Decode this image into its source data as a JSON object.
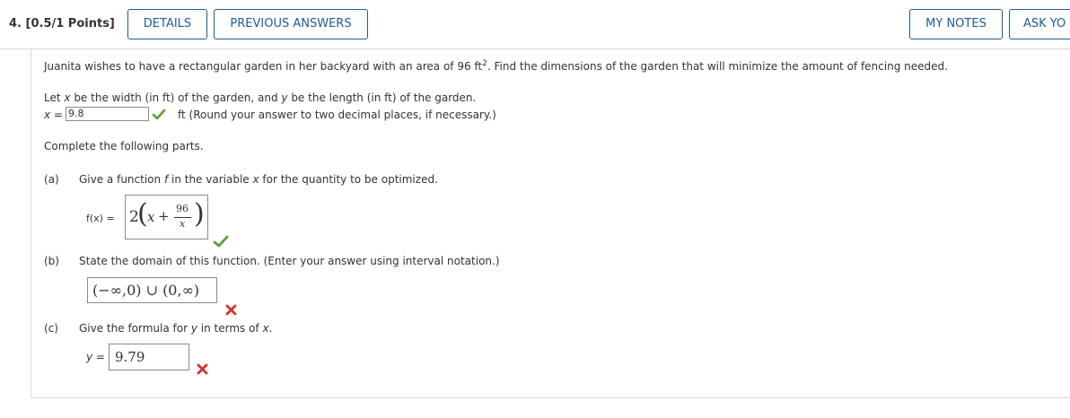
{
  "header": {
    "question_number": "4.",
    "points": "[0.5/1 Points]",
    "details_label": "DETAILS",
    "previous_answers_label": "PREVIOUS ANSWERS",
    "my_notes_label": "MY NOTES",
    "ask_label": "ASK YO"
  },
  "question": {
    "intro_before": "Juanita wishes to have a rectangular garden in her backyard with an area of 96 ft",
    "intro_sup": "2",
    "intro_after": ". Find the dimensions of the garden that will minimize the amount of fencing needed.",
    "let_line": {
      "p1": "Let ",
      "v1": "x",
      "p2": " be the width (in ft) of the garden, and ",
      "v2": "y",
      "p3": " be the length (in ft) of the garden."
    },
    "x_answer": {
      "label_var": "x",
      "label_eq": " =",
      "value": "9.8",
      "status": "correct",
      "hint": "ft (Round your answer to two decimal places, if necessary.)"
    },
    "complete_text": "Complete the following parts.",
    "parts": {
      "a": {
        "letter": "(a)",
        "p1": "Give a function ",
        "v1": "f",
        "p2": " in the variable ",
        "v2": "x",
        "p3": " for the quantity to be optimized.",
        "label": "f(x)  =",
        "answer": {
          "coef": "2",
          "var": "x",
          "plus": "+",
          "numerator": "96",
          "denominator": "x"
        },
        "status": "correct"
      },
      "b": {
        "letter": "(b)",
        "text": "State the domain of this function. (Enter your answer using interval notation.)",
        "answer": "(−∞,0) ∪ (0,∞)",
        "status": "incorrect"
      },
      "c": {
        "letter": "(c)",
        "p1": "Give the formula for ",
        "v1": "y",
        "p2": " in terms of ",
        "v2": "x",
        "p3": ".",
        "label_var": "y",
        "label_eq": " =",
        "answer": "9.79",
        "status": "incorrect"
      }
    }
  },
  "colors": {
    "accent": "#1f5c99",
    "correct": "#5ba02a",
    "incorrect": "#d9302c"
  }
}
